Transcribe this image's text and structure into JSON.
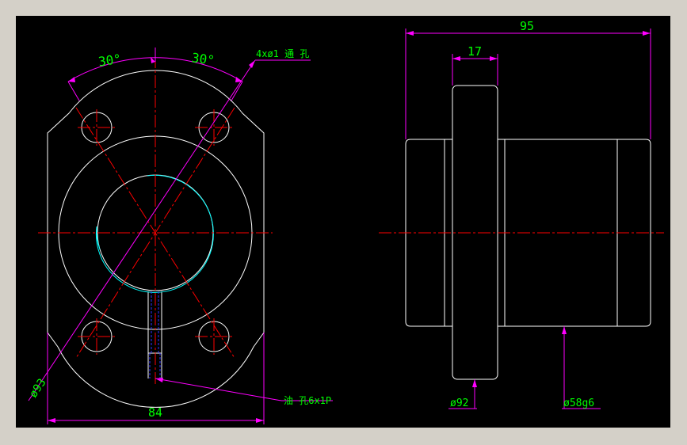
{
  "drawing": {
    "dimensions": {
      "angle_left": "30°",
      "angle_right": "30°",
      "holes": "4xø1 通 孔",
      "bolt_circle": "ø93",
      "width": "84",
      "oil_port": "油 孔6x1P",
      "length": "95",
      "flange_thickness": "17",
      "flange_diameter": "ø92",
      "body_diameter": "ø58g6"
    },
    "colors": {
      "background": "#000000",
      "frame": "#d4d0c8",
      "outline": "#ffffff",
      "dimension": "#ff00ff",
      "centerline": "#ff0000",
      "thread": "#00ffff",
      "hidden": "#0000ff",
      "text": "#00ff00"
    }
  }
}
